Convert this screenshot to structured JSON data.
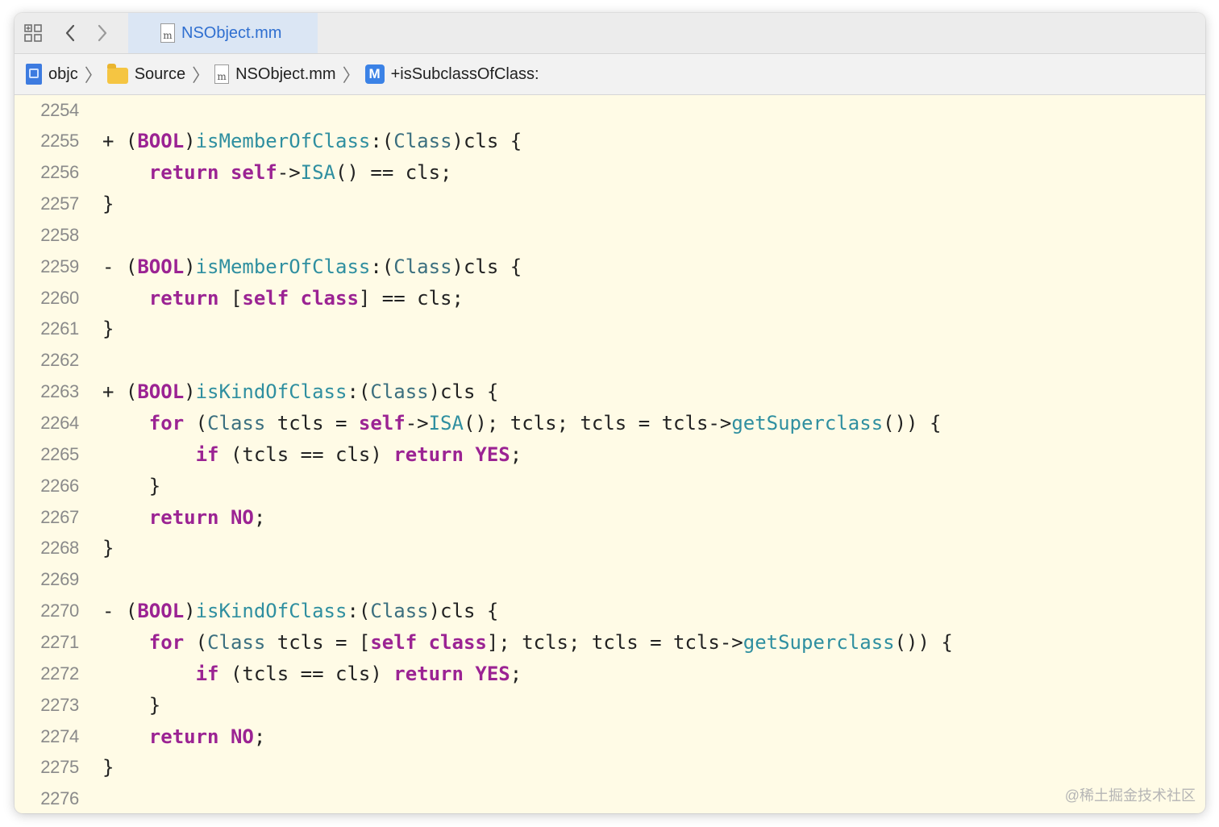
{
  "tabbar": {
    "active_tab": {
      "label": "NSObject.mm",
      "icon": "objc-file-icon",
      "icon_letter": "m"
    }
  },
  "breadcrumb": {
    "items": [
      {
        "label": "objc",
        "icon": "project-icon"
      },
      {
        "label": "Source",
        "icon": "folder-icon"
      },
      {
        "label": "NSObject.mm",
        "icon": "objc-file-icon",
        "icon_letter": "m"
      },
      {
        "label": "+isSubclassOfClass:",
        "icon": "method-icon",
        "icon_letter": "M"
      }
    ],
    "separator": "〉"
  },
  "editor": {
    "lines": [
      {
        "n": "2254",
        "tokens": []
      },
      {
        "n": "2255",
        "tokens": [
          [
            "pl",
            "+ ("
          ],
          [
            "kw",
            "BOOL"
          ],
          [
            "pl",
            ")"
          ],
          [
            "fn",
            "isMemberOfClass"
          ],
          [
            "pl",
            ":("
          ],
          [
            "ty",
            "Class"
          ],
          [
            "pl",
            ")cls {"
          ]
        ]
      },
      {
        "n": "2256",
        "tokens": [
          [
            "pl",
            "    "
          ],
          [
            "kw",
            "return"
          ],
          [
            "pl",
            " "
          ],
          [
            "kw",
            "self"
          ],
          [
            "pl",
            "->"
          ],
          [
            "fn",
            "ISA"
          ],
          [
            "pl",
            "() == cls;"
          ]
        ]
      },
      {
        "n": "2257",
        "tokens": [
          [
            "pl",
            "}"
          ]
        ]
      },
      {
        "n": "2258",
        "tokens": []
      },
      {
        "n": "2259",
        "tokens": [
          [
            "pl",
            "- ("
          ],
          [
            "kw",
            "BOOL"
          ],
          [
            "pl",
            ")"
          ],
          [
            "fn",
            "isMemberOfClass"
          ],
          [
            "pl",
            ":("
          ],
          [
            "ty",
            "Class"
          ],
          [
            "pl",
            ")cls {"
          ]
        ]
      },
      {
        "n": "2260",
        "tokens": [
          [
            "pl",
            "    "
          ],
          [
            "kw",
            "return"
          ],
          [
            "pl",
            " ["
          ],
          [
            "kw",
            "self"
          ],
          [
            "pl",
            " "
          ],
          [
            "kw",
            "class"
          ],
          [
            "pl",
            "] == cls;"
          ]
        ]
      },
      {
        "n": "2261",
        "tokens": [
          [
            "pl",
            "}"
          ]
        ]
      },
      {
        "n": "2262",
        "tokens": []
      },
      {
        "n": "2263",
        "tokens": [
          [
            "pl",
            "+ ("
          ],
          [
            "kw",
            "BOOL"
          ],
          [
            "pl",
            ")"
          ],
          [
            "fn",
            "isKindOfClass"
          ],
          [
            "pl",
            ":("
          ],
          [
            "ty",
            "Class"
          ],
          [
            "pl",
            ")cls {"
          ]
        ]
      },
      {
        "n": "2264",
        "tokens": [
          [
            "pl",
            "    "
          ],
          [
            "kw",
            "for"
          ],
          [
            "pl",
            " ("
          ],
          [
            "ty",
            "Class"
          ],
          [
            "pl",
            " tcls = "
          ],
          [
            "kw",
            "self"
          ],
          [
            "pl",
            "->"
          ],
          [
            "fn",
            "ISA"
          ],
          [
            "pl",
            "(); tcls; tcls = tcls->"
          ],
          [
            "fn",
            "getSuperclass"
          ],
          [
            "pl",
            "()) {"
          ]
        ]
      },
      {
        "n": "2265",
        "tokens": [
          [
            "pl",
            "        "
          ],
          [
            "kw",
            "if"
          ],
          [
            "pl",
            " (tcls == cls) "
          ],
          [
            "kw",
            "return"
          ],
          [
            "pl",
            " "
          ],
          [
            "kw",
            "YES"
          ],
          [
            "pl",
            ";"
          ]
        ]
      },
      {
        "n": "2266",
        "tokens": [
          [
            "pl",
            "    }"
          ]
        ]
      },
      {
        "n": "2267",
        "tokens": [
          [
            "pl",
            "    "
          ],
          [
            "kw",
            "return"
          ],
          [
            "pl",
            " "
          ],
          [
            "kw",
            "NO"
          ],
          [
            "pl",
            ";"
          ]
        ]
      },
      {
        "n": "2268",
        "tokens": [
          [
            "pl",
            "}"
          ]
        ]
      },
      {
        "n": "2269",
        "tokens": []
      },
      {
        "n": "2270",
        "tokens": [
          [
            "pl",
            "- ("
          ],
          [
            "kw",
            "BOOL"
          ],
          [
            "pl",
            ")"
          ],
          [
            "fn",
            "isKindOfClass"
          ],
          [
            "pl",
            ":("
          ],
          [
            "ty",
            "Class"
          ],
          [
            "pl",
            ")cls {"
          ]
        ]
      },
      {
        "n": "2271",
        "tokens": [
          [
            "pl",
            "    "
          ],
          [
            "kw",
            "for"
          ],
          [
            "pl",
            " ("
          ],
          [
            "ty",
            "Class"
          ],
          [
            "pl",
            " tcls = ["
          ],
          [
            "kw",
            "self"
          ],
          [
            "pl",
            " "
          ],
          [
            "kw",
            "class"
          ],
          [
            "pl",
            "]; tcls; tcls = tcls->"
          ],
          [
            "fn",
            "getSuperclass"
          ],
          [
            "pl",
            "()) {"
          ]
        ]
      },
      {
        "n": "2272",
        "tokens": [
          [
            "pl",
            "        "
          ],
          [
            "kw",
            "if"
          ],
          [
            "pl",
            " (tcls == cls) "
          ],
          [
            "kw",
            "return"
          ],
          [
            "pl",
            " "
          ],
          [
            "kw",
            "YES"
          ],
          [
            "pl",
            ";"
          ]
        ]
      },
      {
        "n": "2273",
        "tokens": [
          [
            "pl",
            "    }"
          ]
        ]
      },
      {
        "n": "2274",
        "tokens": [
          [
            "pl",
            "    "
          ],
          [
            "kw",
            "return"
          ],
          [
            "pl",
            " "
          ],
          [
            "kw",
            "NO"
          ],
          [
            "pl",
            ";"
          ]
        ]
      },
      {
        "n": "2275",
        "tokens": [
          [
            "pl",
            "}"
          ]
        ]
      },
      {
        "n": "2276",
        "tokens": []
      }
    ]
  },
  "colors": {
    "editor_background": "#fffbe6",
    "keyword": "#9b2393",
    "type": "#3b6f7f",
    "function": "#2f8fa0",
    "plain": "#222222",
    "line_number": "#8a8a8a",
    "active_tab": "#dbe6f4"
  },
  "watermark": "@稀土掘金技术社区"
}
